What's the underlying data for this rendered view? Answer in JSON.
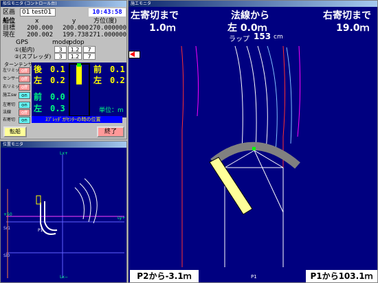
{
  "nav_window": {
    "title": "船位モニタ (コントロール台)",
    "area_label": "区画",
    "area_value": "01 test01",
    "clock": "10:43:58",
    "pos_header": {
      "label": "船位",
      "x": "x",
      "y": "y",
      "dir": "方位(度)"
    },
    "target": {
      "label": "目標",
      "x": "200.000",
      "y": "200.000",
      "dir": "270.000000"
    },
    "current": {
      "label": "現在",
      "x": "200.002",
      "y": "199.738",
      "dir": "271.000000"
    },
    "gps": {
      "label": "GPS",
      "mode_h": "mode",
      "pdop_h": "pdop",
      "rows": [
        {
          "label": "①(船内)",
          "mode": "3",
          "pdop": "1.2",
          "n": "7"
        },
        {
          "label": "②(スプレッダ)",
          "mode": "3",
          "pdop": "1.2",
          "n": "7"
        }
      ]
    },
    "section_label": "ターンテンサー",
    "switches": [
      {
        "label": "左リミット",
        "state": "off"
      },
      {
        "label": "センサー",
        "state": "off"
      },
      {
        "label": "右リミット",
        "state": "off"
      },
      {
        "label": "施工sw",
        "state": "on"
      },
      {
        "label": "左寄切",
        "state": "on"
      },
      {
        "label": "法線",
        "state": "off"
      },
      {
        "label": "右寄切",
        "state": "on"
      }
    ],
    "readouts": {
      "back": {
        "label": "後",
        "value": "0.1"
      },
      "left1": {
        "label": "左",
        "value": "0.2"
      },
      "front": {
        "label": "前",
        "value": "0.1"
      },
      "left2": {
        "label": "左",
        "value": "0.2"
      },
      "front2": {
        "label": "前",
        "value": "0.0"
      },
      "left3": {
        "label": "左",
        "value": "0.3"
      }
    },
    "unit": "単位：m",
    "status_bar": "ｽﾌﾟﾚｯﾀﾞがｾﾝﾀｰの時の位置",
    "turn_button": "転船",
    "end_button": "終了"
  },
  "map_window": {
    "title": "位置モニタ",
    "labels": {
      "top": "Lx+",
      "bottom": "Lx−",
      "right": "Ly+",
      "left_y": "+50",
      "sr": "Sr1",
      "sl": "Sl0",
      "p1": "P1"
    }
  },
  "work_window": {
    "title": "施工モニタ",
    "left_title": "左寄切まで",
    "left_value": "1.0ｍ",
    "center_title": "法線から",
    "center_value": "左 0.0ｍ",
    "right_title": "右寄切まで",
    "right_value": "19.0ｍ",
    "lap_label": "ラップ",
    "lap_value": "153",
    "lap_unit": "cm",
    "p1_label": "P1",
    "bottom_left": "P2から-3.1ｍ",
    "bottom_right": "P1から103.1ｍ"
  },
  "colors": {
    "navy": "#000080",
    "readout": "#ffff00",
    "green": "#00ff80",
    "off": "#ff9999",
    "on": "#66ffff"
  }
}
